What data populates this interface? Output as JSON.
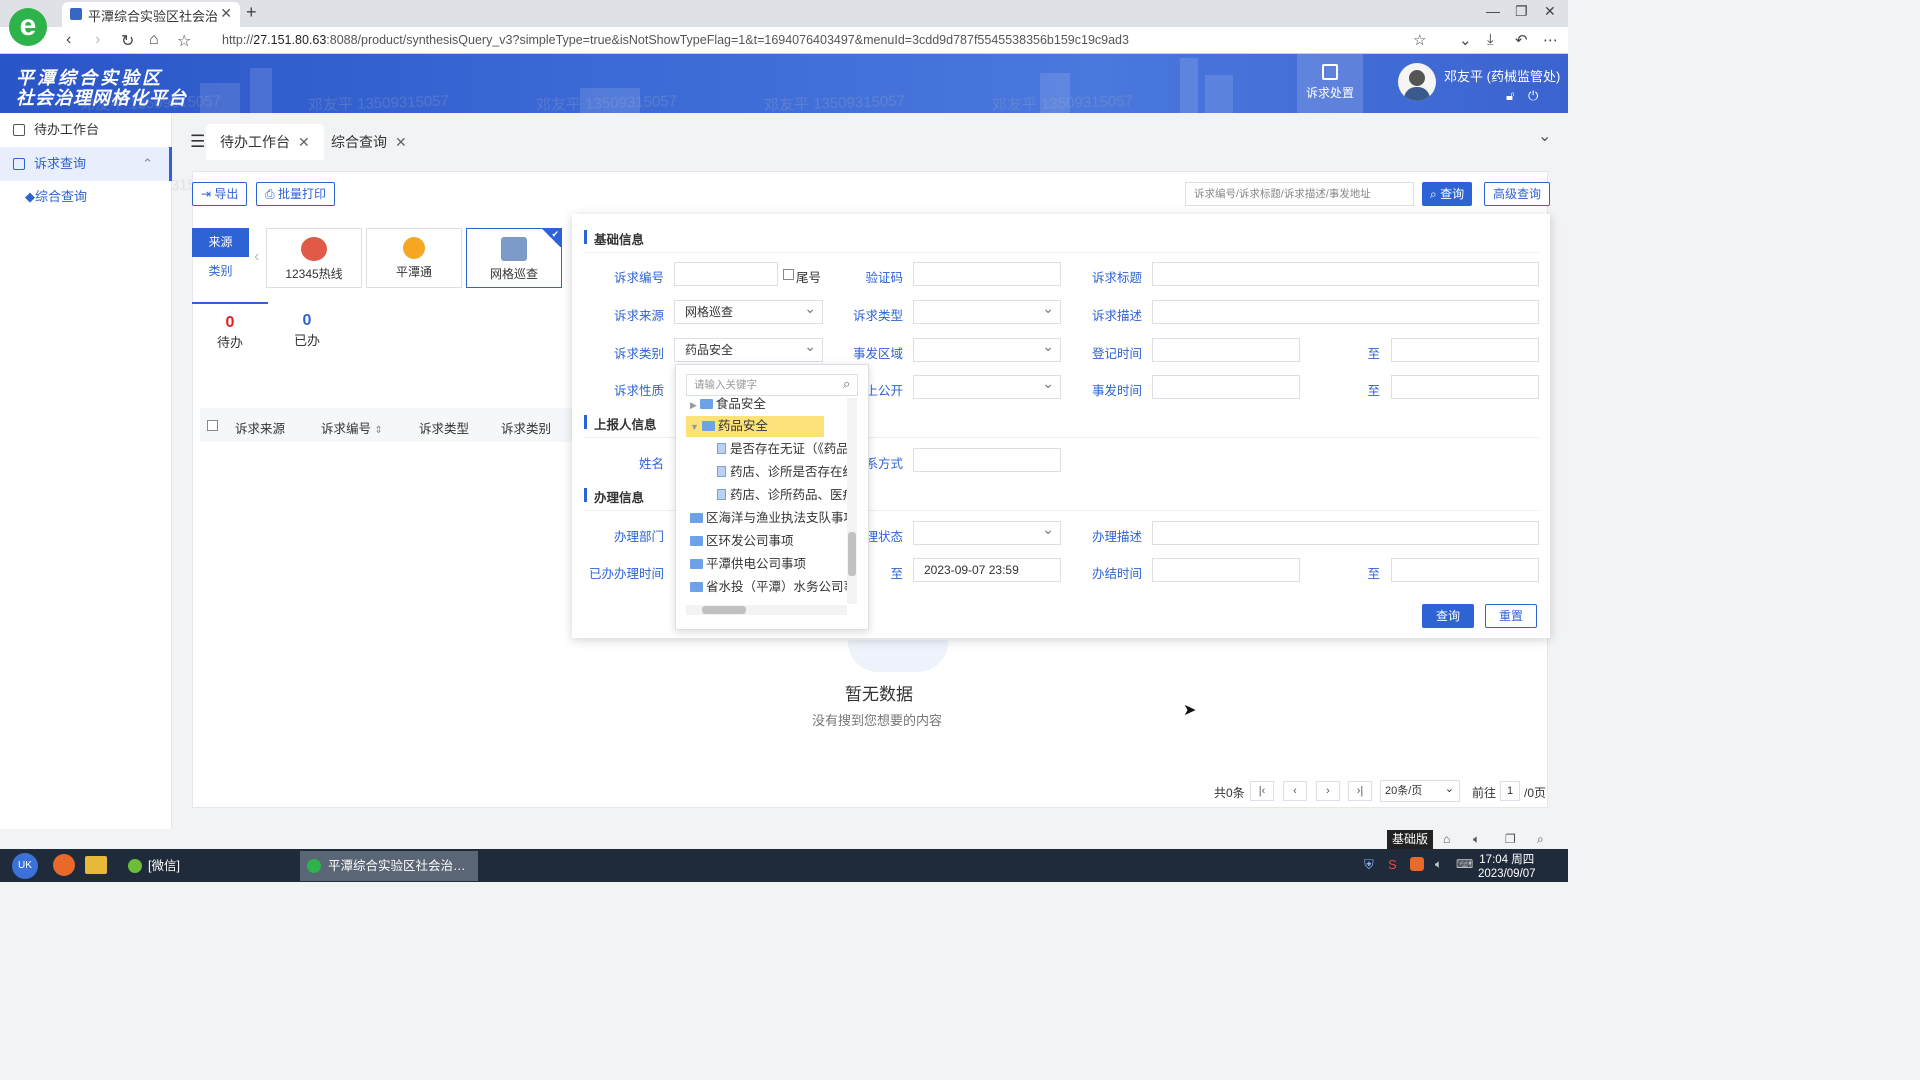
{
  "browser": {
    "tab_title": "平潭综合实验区社会治",
    "url_host": "27.151.80.63",
    "url_prefix": "http://",
    "url_rest": ":8088/product/synthesisQuery_v3?simpleType=true&isNotShowTypeFlag=1&t=1694076403497&menuId=3cdd9d787f5545538356b159c19c9ad3"
  },
  "app": {
    "title_line1": "平潭综合实验区",
    "title_line2": "社会治理网格化平台",
    "suqiu_chuzhi": "诉求处置",
    "username": "邓友平 (药械监管处)",
    "watermark": "邓友平 13509315057"
  },
  "sidebar": {
    "items": [
      {
        "label": "待办工作台"
      },
      {
        "label": "诉求查询"
      }
    ],
    "sub": "◆综合查询"
  },
  "tabs": [
    {
      "label": "待办工作台"
    },
    {
      "label": "综合查询"
    }
  ],
  "toolbar": {
    "export": "导出",
    "batch_print": "批量打印",
    "search_placeholder": "诉求编号/诉求标题/诉求描述/事发地址",
    "query": "查询",
    "advanced_query": "高级查询"
  },
  "source": {
    "label1": "来源",
    "label2": "类别",
    "cards": [
      {
        "label": "12345热线",
        "icon": "hotline-12345-icon"
      },
      {
        "label": "平潭通",
        "icon": "pingtantong-icon"
      },
      {
        "label": "网格巡查",
        "icon": "grid-patrol-icon"
      }
    ]
  },
  "counts": [
    {
      "value": "0",
      "label": "待办"
    },
    {
      "value": "0",
      "label": "已办"
    }
  ],
  "table": {
    "columns": [
      "诉求来源",
      "诉求编号",
      "诉求类型",
      "诉求类别"
    ]
  },
  "empty": {
    "title": "暂无数据",
    "subtitle": "没有搜到您想要的内容"
  },
  "pager": {
    "total": "共0条",
    "page_size": "20条/页",
    "goto": "前往",
    "page": "1",
    "pages": "/0页"
  },
  "adv": {
    "sec_basic": "基础信息",
    "sec_reporter": "上报人信息",
    "sec_handle": "办理信息",
    "labels": {
      "code": "诉求编号",
      "tail": "尾号",
      "verify": "验证码",
      "title": "诉求标题",
      "source": "诉求来源",
      "type": "诉求类型",
      "desc": "诉求描述",
      "category": "诉求类别",
      "area": "事发区域",
      "reg_time": "登记时间",
      "to": "至",
      "nature": "诉求性质",
      "public": "上公开",
      "event_time": "事发时间",
      "name": "姓名",
      "contact": "系方式",
      "dept": "办理部门",
      "state": "理状态",
      "handle_desc": "办理描述",
      "done_time": "已办办理时间",
      "finish_time": "办结时间"
    },
    "values": {
      "source": "网格巡查",
      "category": "药品安全",
      "done_time_to": "2023-09-07 23:59"
    },
    "buttons": {
      "query": "查询",
      "reset": "重置"
    }
  },
  "tree": {
    "placeholder": "请输入关键字",
    "rows": [
      "食品安全",
      "药品安全",
      "是否存在无证（《药品",
      "药店、诊所是否存在经",
      "药店、诊所药品、医疗",
      "区海洋与渔业执法支队事项",
      "区环发公司事项",
      "平潭供电公司事项",
      "省水投（平潭）水务公司事项"
    ]
  },
  "statusbar": {
    "edition": "基础版"
  },
  "taskbar": {
    "wechat": "[微信]",
    "browser_task": "平潭综合实验区社会治…",
    "time": "17:04 周四",
    "date": "2023/09/07"
  }
}
